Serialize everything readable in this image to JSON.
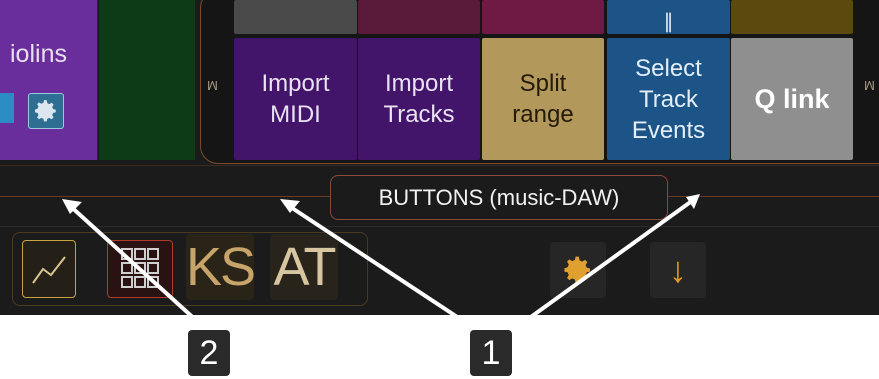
{
  "instrument": {
    "label": "iolins"
  },
  "group": {
    "side_label_left": "M",
    "side_label_right": "M"
  },
  "buttons": [
    {
      "label": "Import\nMIDI",
      "line1": "Import",
      "line2": "MIDI"
    },
    {
      "label": "Import\nTracks",
      "line1": "Import",
      "line2": "Tracks"
    },
    {
      "label": "Split\nrange",
      "line1": "Split",
      "line2": "range"
    },
    {
      "label": "Select Track Events",
      "line1": "Select",
      "line2": "Track",
      "line3": "Events"
    },
    {
      "label": "Q link"
    }
  ],
  "top_caps": {
    "select_cap_glyph": "∥"
  },
  "tooltip": {
    "text": "BUTTONS (music-DAW)"
  },
  "toolbar": {
    "ks_label": "KS",
    "at_label": "AT",
    "down_glyph": "↓"
  },
  "callouts": [
    {
      "number": "2"
    },
    {
      "number": "1"
    }
  ],
  "colors": {
    "violin": "#6a2e9c",
    "import": "#42156a",
    "split": "#b2985a",
    "select": "#1d5488",
    "qlink": "#8f8f8f",
    "accent_gold": "#c9a340"
  },
  "icons": [
    "gear-icon",
    "graph-icon",
    "grid-icon",
    "down-arrow-icon",
    "arrow-icon"
  ]
}
